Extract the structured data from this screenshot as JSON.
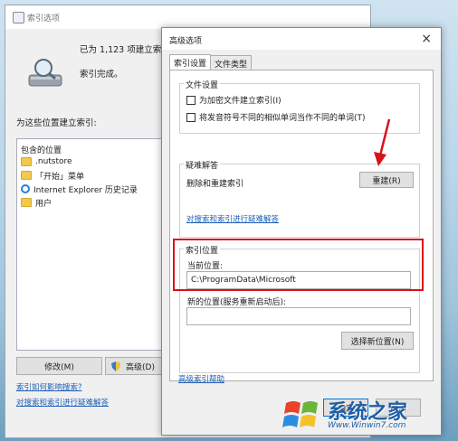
{
  "back_window": {
    "title": "索引选项",
    "index_count": "已为 1,123 项建立索引",
    "status": "索引完成。",
    "locations_label": "为这些位置建立索引:",
    "locations_header": "包含的位置",
    "locations": [
      {
        "icon": "folder-icon",
        "label": ".nutstore"
      },
      {
        "icon": "folder-icon",
        "label": "「开始」菜单"
      },
      {
        "icon": "ie-icon",
        "label": "Internet Explorer 历史记录"
      },
      {
        "icon": "folder-icon",
        "label": "用户"
      }
    ],
    "modify_button": "修改(M)",
    "advanced_button": "高级(D)",
    "link_how_index": "索引如何影响搜索?",
    "link_troubleshoot": "对搜索和索引进行疑难解答"
  },
  "front_window": {
    "title": "高级选项",
    "close_glyph": "×",
    "tabs": [
      "索引设置",
      "文件类型"
    ],
    "file_settings": {
      "title": "文件设置",
      "encrypt_label": "为加密文件建立索引(I)",
      "diacritics_label": "将发音符号不同的相似单词当作不同的单词(T)"
    },
    "troubleshooting": {
      "title": "疑难解答",
      "rebuild_text": "删除和重建索引",
      "rebuild_button": "重建(R)",
      "link": "对搜索和索引进行疑难解答"
    },
    "index_location": {
      "title": "索引位置",
      "current_label": "当前位置:",
      "current_value": "C:\\ProgramData\\Microsoft",
      "new_label": "新的位置(服务重新启动后):",
      "new_value": "",
      "select_button": "选择新位置(N)"
    },
    "help_link": "高级索引帮助",
    "ok_button": "确定",
    "cancel_button": "取消"
  },
  "watermark": {
    "brand": "系统之家",
    "url": "Www.Winwin7.com"
  },
  "colors": {
    "highlight": "#d8121a",
    "link": "#1d5fb7"
  }
}
